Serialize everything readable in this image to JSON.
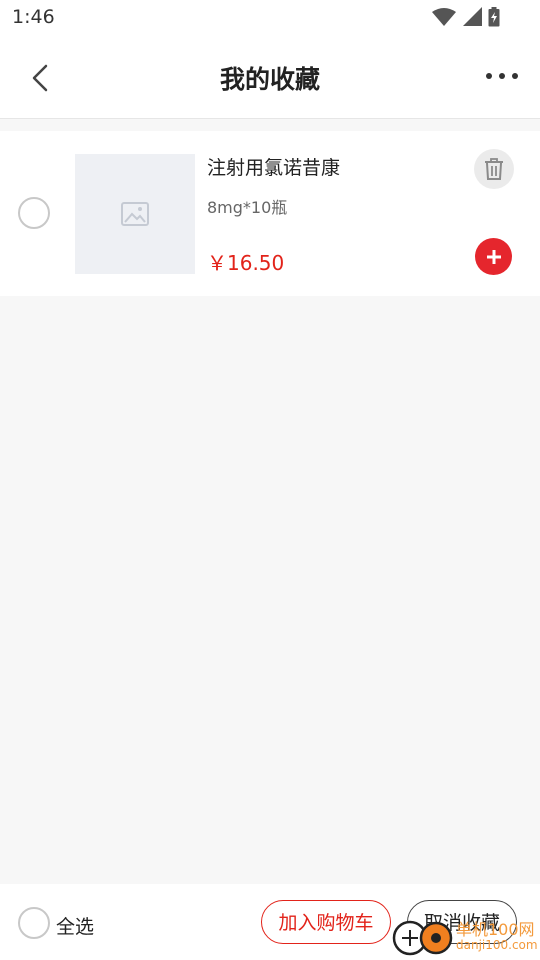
{
  "status_bar": {
    "time": "1:46"
  },
  "header": {
    "title": "我的收藏"
  },
  "items": [
    {
      "name": "注射用氯诺昔康",
      "spec": "8mg*10瓶",
      "price": "￥16.50"
    }
  ],
  "bottom_bar": {
    "select_all_label": "全选",
    "add_to_cart_label": "加入购物车",
    "cancel_favorite_label": "取消收藏"
  },
  "watermark": {
    "text": "单机100网",
    "url": "danji100.com"
  },
  "colors": {
    "accent": "#e2231a",
    "add_button": "#e5262d",
    "background": "#f7f7f7"
  },
  "icons": [
    "back-arrow-icon",
    "more-icon",
    "image-placeholder-icon",
    "trash-icon",
    "plus-icon",
    "wifi-icon",
    "signal-icon",
    "battery-icon"
  ]
}
